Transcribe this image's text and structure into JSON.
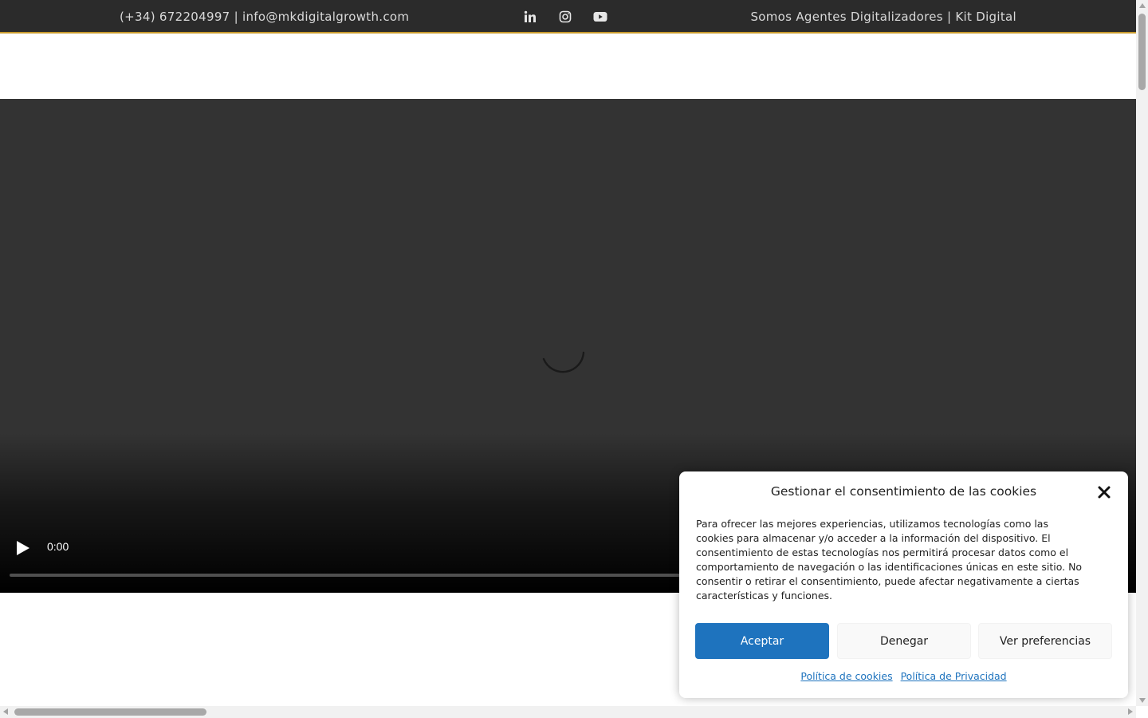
{
  "topbar": {
    "contact": "(+34) 672204997 | info@mkdigitalgrowth.com",
    "tagline": "Somos Agentes Digitalizadores | Kit Digital",
    "social": [
      "linkedin-icon",
      "instagram-icon",
      "youtube-icon"
    ],
    "background": "#2b2b2b",
    "accent": "#c79a2c"
  },
  "video": {
    "time": "0:00",
    "progress": 0
  },
  "cookie": {
    "title": "Gestionar el consentimiento de las cookies",
    "body": "Para ofrecer las mejores experiencias, utilizamos tecnologías como las cookies para almacenar y/o acceder a la información del dispositivo. El consentimiento de estas tecnologías nos permitirá procesar datos como el comportamiento de navegación o las identificaciones únicas en este sitio. No consentir o retirar el consentimiento, puede afectar negativamente a ciertas características y funciones.",
    "accept_label": "Aceptar",
    "deny_label": "Denegar",
    "prefs_label": "Ver preferencias",
    "cookie_policy_link": "Política de cookies",
    "privacy_policy_link": "Política de Privacidad",
    "accent": "#1e73be"
  }
}
